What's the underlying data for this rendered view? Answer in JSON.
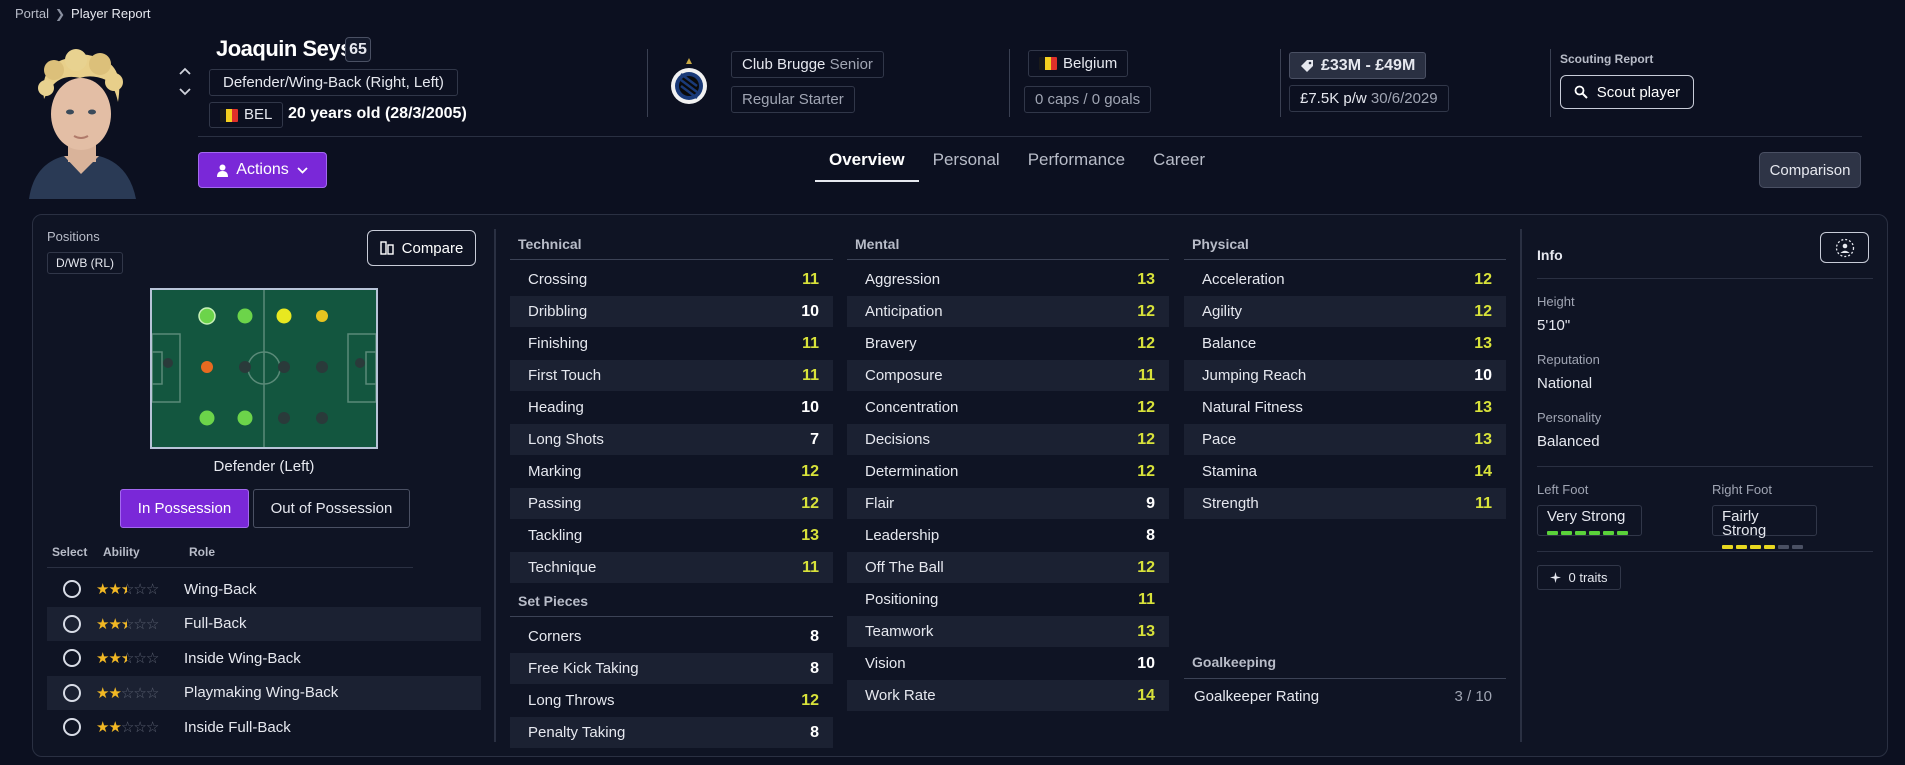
{
  "breadcrumb": {
    "root": "Portal",
    "current": "Player Report"
  },
  "player": {
    "name": "Joaquin Seys",
    "ability": "65",
    "position": "Defender/Wing-Back (Right, Left)",
    "nationality_code": "BEL",
    "age": "20 years old (28/3/2005)"
  },
  "club": {
    "name": "Club Brugge",
    "squad": "Senior",
    "status": "Regular Starter"
  },
  "nation": {
    "name": "Belgium",
    "caps": "0 caps / 0 goals"
  },
  "contract": {
    "value": "£33M - £49M",
    "wage": "£7.5K p/w",
    "expiry": "30/6/2029"
  },
  "scouting": {
    "label": "Scouting Report",
    "button": "Scout player"
  },
  "actions_label": "Actions",
  "tabs": [
    "Overview",
    "Personal",
    "Performance",
    "Career"
  ],
  "comparison_label": "Comparison",
  "positions": {
    "label": "Positions",
    "tag": "D/WB (RL)",
    "compare_label": "Compare",
    "pitch_caption": "Defender (Left)",
    "in_possession": "In Possession",
    "out_possession": "Out of Possession"
  },
  "roles_header": {
    "select": "Select",
    "ability": "Ability",
    "role": "Role"
  },
  "roles": [
    {
      "name": "Wing-Back",
      "stars": 2.5
    },
    {
      "name": "Full-Back",
      "stars": 2.5
    },
    {
      "name": "Inside Wing-Back",
      "stars": 2.5
    },
    {
      "name": "Playmaking Wing-Back",
      "stars": 2
    },
    {
      "name": "Inside Full-Back",
      "stars": 2
    }
  ],
  "technical": {
    "title": "Technical",
    "items": [
      {
        "name": "Crossing",
        "value": "11"
      },
      {
        "name": "Dribbling",
        "value": "10"
      },
      {
        "name": "Finishing",
        "value": "11"
      },
      {
        "name": "First Touch",
        "value": "11"
      },
      {
        "name": "Heading",
        "value": "10"
      },
      {
        "name": "Long Shots",
        "value": "7"
      },
      {
        "name": "Marking",
        "value": "12"
      },
      {
        "name": "Passing",
        "value": "12"
      },
      {
        "name": "Tackling",
        "value": "13"
      },
      {
        "name": "Technique",
        "value": "11"
      }
    ]
  },
  "set_pieces": {
    "title": "Set Pieces",
    "items": [
      {
        "name": "Corners",
        "value": "8"
      },
      {
        "name": "Free Kick Taking",
        "value": "8"
      },
      {
        "name": "Long Throws",
        "value": "12"
      },
      {
        "name": "Penalty Taking",
        "value": "8"
      }
    ]
  },
  "mental": {
    "title": "Mental",
    "items": [
      {
        "name": "Aggression",
        "value": "13"
      },
      {
        "name": "Anticipation",
        "value": "12"
      },
      {
        "name": "Bravery",
        "value": "12"
      },
      {
        "name": "Composure",
        "value": "11"
      },
      {
        "name": "Concentration",
        "value": "12"
      },
      {
        "name": "Decisions",
        "value": "12"
      },
      {
        "name": "Determination",
        "value": "12"
      },
      {
        "name": "Flair",
        "value": "9"
      },
      {
        "name": "Leadership",
        "value": "8"
      },
      {
        "name": "Off The Ball",
        "value": "12"
      },
      {
        "name": "Positioning",
        "value": "11"
      },
      {
        "name": "Teamwork",
        "value": "13"
      },
      {
        "name": "Vision",
        "value": "10"
      },
      {
        "name": "Work Rate",
        "value": "14"
      }
    ]
  },
  "physical": {
    "title": "Physical",
    "items": [
      {
        "name": "Acceleration",
        "value": "12"
      },
      {
        "name": "Agility",
        "value": "12"
      },
      {
        "name": "Balance",
        "value": "13"
      },
      {
        "name": "Jumping Reach",
        "value": "10"
      },
      {
        "name": "Natural Fitness",
        "value": "13"
      },
      {
        "name": "Pace",
        "value": "13"
      },
      {
        "name": "Stamina",
        "value": "14"
      },
      {
        "name": "Strength",
        "value": "11"
      }
    ]
  },
  "goalkeeping": {
    "title": "Goalkeeping",
    "label": "Goalkeeper Rating",
    "value": "3 / 10"
  },
  "info": {
    "title": "Info",
    "height_label": "Height",
    "height": "5'10\"",
    "reputation_label": "Reputation",
    "reputation": "National",
    "personality_label": "Personality",
    "personality": "Balanced",
    "left_foot_label": "Left Foot",
    "left_foot": "Very Strong",
    "left_foot_level": 6,
    "right_foot_label": "Right Foot",
    "right_foot": "Fairly Strong",
    "right_foot_level": 4,
    "traits": "0 traits"
  },
  "colors": {
    "accent": "#7a28d8",
    "value_high": "#d8e23a",
    "value_mid": "#ffffff",
    "star": "#f2b824"
  }
}
